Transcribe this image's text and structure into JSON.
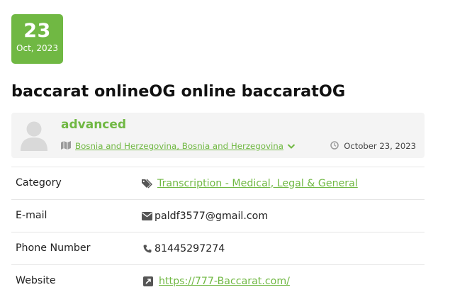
{
  "date_badge": {
    "day": "23",
    "month": "Oct, 2023"
  },
  "title": "baccarat onlineOG online baccaratOG",
  "author": {
    "name": "advanced",
    "location": "Bosnia and Herzegovina, Bosnia and Herzegovina",
    "date": "October 23, 2023"
  },
  "details": [
    {
      "label": "Category",
      "value": "Transcription - Medical, Legal & General",
      "icon": "tags-icon"
    },
    {
      "label": "E-mail",
      "value": "paldf3577@gmail.com",
      "icon": "envelope-icon"
    },
    {
      "label": "Phone Number",
      "value": "81445297274",
      "icon": "phone-icon"
    },
    {
      "label": "Website",
      "value": "https://777-Baccarat.com/",
      "icon": "external-link-icon"
    }
  ],
  "colors": {
    "accent": "#70b843",
    "text": "#222222",
    "panel": "#f4f4f4"
  }
}
